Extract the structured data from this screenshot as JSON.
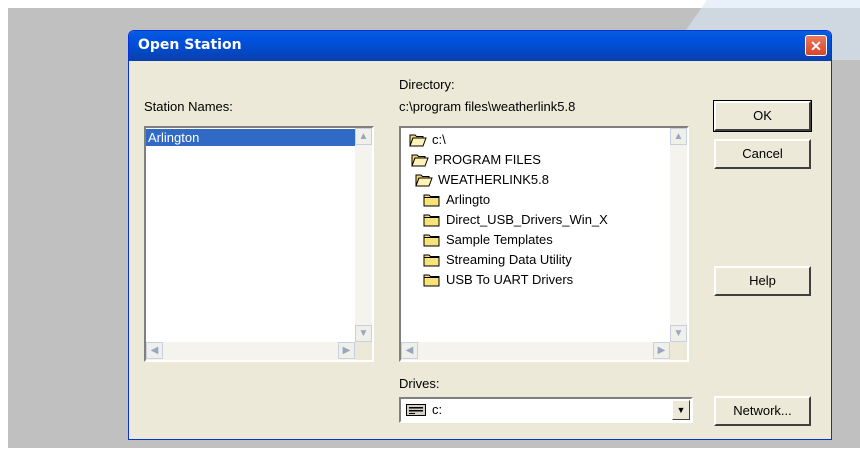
{
  "dialog": {
    "title": "Open Station",
    "close_glyph": "✕"
  },
  "station_names": {
    "label": "Station Names:",
    "items": [
      "Arlington"
    ],
    "selected": "Arlington"
  },
  "directory": {
    "label": "Directory:",
    "current_path": "c:\\program files\\weatherlink5.8",
    "tree": [
      {
        "name": "c:\\",
        "icon": "open-folder-icon",
        "level": 0
      },
      {
        "name": "PROGRAM FILES",
        "icon": "open-folder-icon",
        "level": 1
      },
      {
        "name": "WEATHERLINK5.8",
        "icon": "open-folder-icon",
        "level": 2
      },
      {
        "name": "Arlingto",
        "icon": "folder-icon",
        "level": 3
      },
      {
        "name": "Direct_USB_Drivers_Win_X",
        "icon": "folder-icon",
        "level": 3
      },
      {
        "name": "Sample Templates",
        "icon": "folder-icon",
        "level": 3
      },
      {
        "name": "Streaming Data Utility",
        "icon": "folder-icon",
        "level": 3
      },
      {
        "name": "USB To UART Drivers",
        "icon": "folder-icon",
        "level": 3
      }
    ]
  },
  "drives": {
    "label": "Drives:",
    "selected": "c:",
    "icon": "drive-icon"
  },
  "buttons": {
    "ok": "OK",
    "cancel": "Cancel",
    "help": "Help",
    "network": "Network..."
  },
  "colors": {
    "titlebar": "#0054e3",
    "selection": "#316ac5",
    "dialog_bg": "#ece9d8",
    "folder": "#f5d96b"
  }
}
